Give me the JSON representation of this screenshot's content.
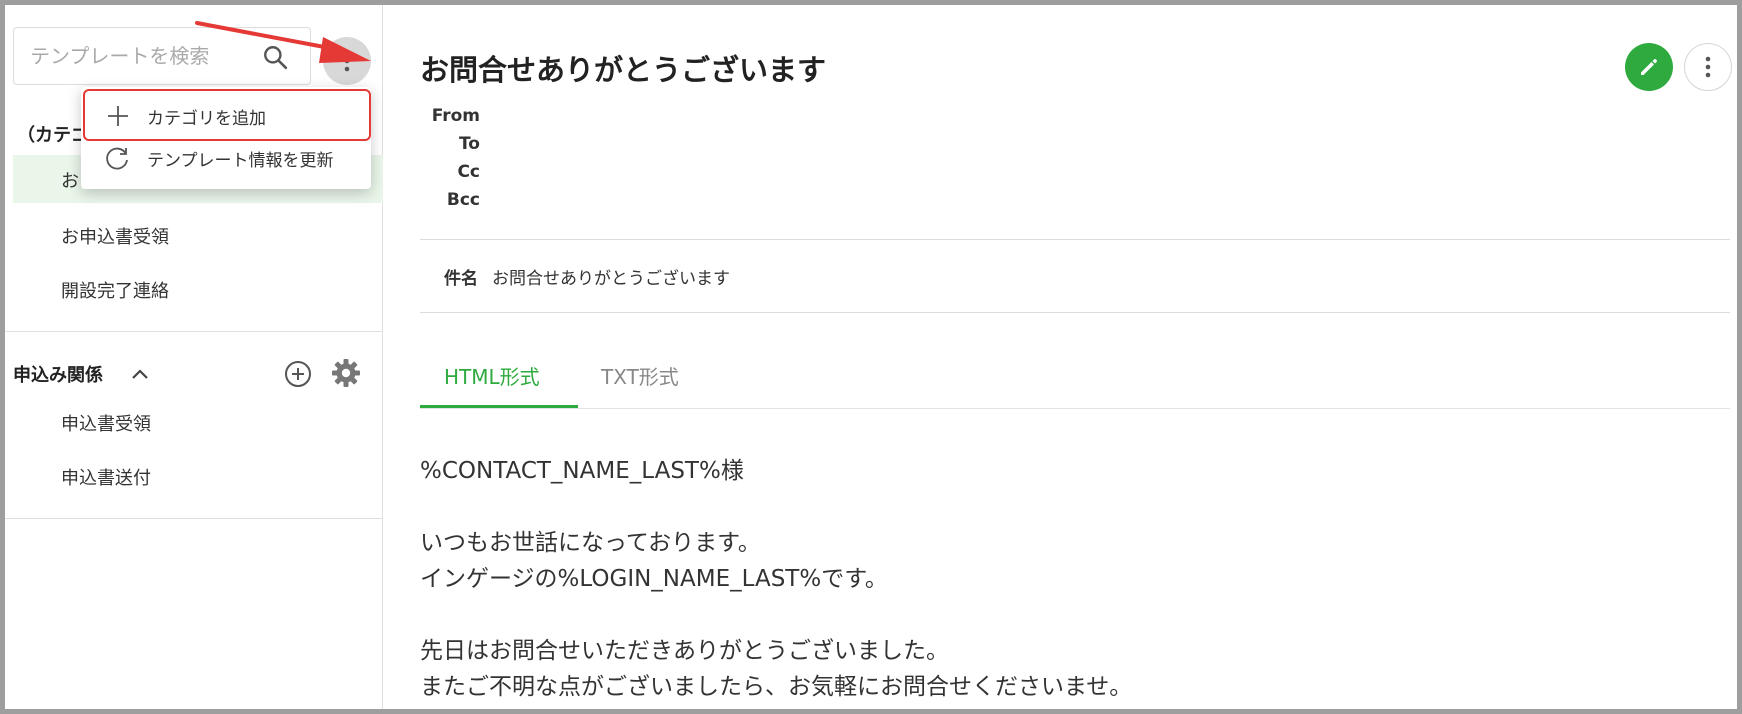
{
  "sidebar": {
    "search_placeholder": "テンプレートを検索",
    "category_partial_label": "（カテゴ",
    "active_item_partial": "お",
    "items_group1": [
      "お申込書受領",
      "開設完了連絡"
    ],
    "group2": {
      "title": "申込み関係",
      "items": [
        "申込書受領",
        "申込書送付"
      ]
    }
  },
  "menu": {
    "items": [
      {
        "label": "カテゴリを追加",
        "icon": "plus-icon"
      },
      {
        "label": "テンプレート情報を更新",
        "icon": "refresh-icon"
      }
    ]
  },
  "main": {
    "title": "お問合せありがとうございます",
    "headers": [
      "From",
      "To",
      "Cc",
      "Bcc"
    ],
    "subject_label": "件名",
    "subject_value": "お問合せありがとうございます",
    "tabs": [
      {
        "label": "HTML形式",
        "active": true
      },
      {
        "label": "TXT形式",
        "active": false
      }
    ],
    "body_lines": [
      "%CONTACT_NAME_LAST%様",
      "いつもお世話になっております。",
      "インゲージの%LOGIN_NAME_LAST%です。",
      "先日はお問合せいただきありがとうございました。",
      "またご不明な点がございましたら、お気軽にお問合せくださいませ。"
    ]
  },
  "colors": {
    "accent_green": "#2eaa3e",
    "annotation_red": "#e53935",
    "active_item_bg": "#eaf6ea"
  }
}
